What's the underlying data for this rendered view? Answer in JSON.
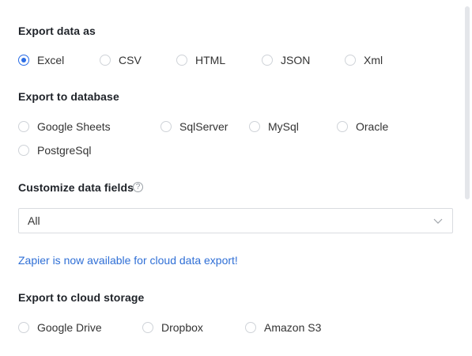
{
  "export_data": {
    "title": "Export data as",
    "options": [
      "Excel",
      "CSV",
      "HTML",
      "JSON",
      "Xml"
    ],
    "selected": "Excel"
  },
  "export_database": {
    "title": "Export to database",
    "options": [
      "Google Sheets",
      "SqlServer",
      "MySql",
      "Oracle",
      "PostgreSql"
    ]
  },
  "customize_fields": {
    "title": "Customize data fields",
    "help_icon": "question-circle-icon",
    "select_value": "All",
    "chevron_icon": "chevron-down-icon"
  },
  "zapier_link": "Zapier is now available for cloud data export!",
  "export_cloud": {
    "title": "Export to cloud storage",
    "options": [
      "Google Drive",
      "Dropbox",
      "Amazon S3"
    ]
  },
  "colors": {
    "accent": "#2b6de5",
    "link": "#2f6fd6",
    "border": "#d9dce0"
  }
}
